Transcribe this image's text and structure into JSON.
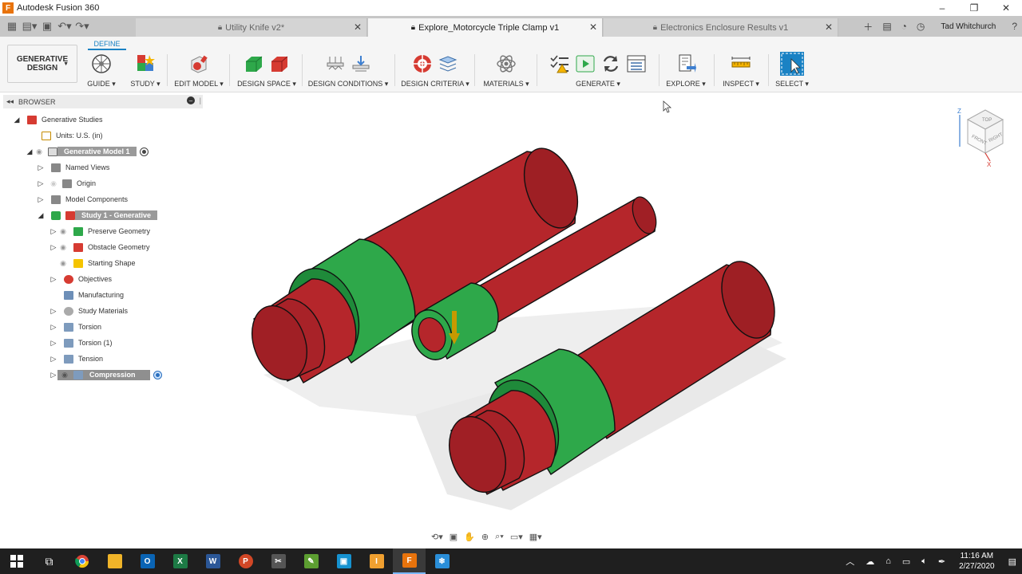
{
  "window": {
    "title": "Autodesk Fusion 360",
    "controls": [
      "–",
      "❐",
      "✕"
    ]
  },
  "tabs": [
    {
      "label": "Utility Knife v2*",
      "active": false
    },
    {
      "label": "Explore_Motorcycle Triple Clamp v1",
      "active": true
    },
    {
      "label": "Electronics Enclosure Results v1",
      "active": false
    }
  ],
  "user": {
    "name": "Tad Whitchurch"
  },
  "toolbar": {
    "define_label": "DEFINE",
    "workspace_label_line1": "GENERATIVE",
    "workspace_label_line2": "DESIGN",
    "groups": [
      {
        "label": "GUIDE ▾"
      },
      {
        "label": "STUDY ▾"
      },
      {
        "label": "EDIT MODEL ▾"
      },
      {
        "label": "DESIGN SPACE ▾"
      },
      {
        "label": "DESIGN CONDITIONS ▾"
      },
      {
        "label": "DESIGN CRITERIA ▾"
      },
      {
        "label": "MATERIALS ▾"
      },
      {
        "label": "GENERATE ▾"
      },
      {
        "label": "EXPLORE ▾"
      },
      {
        "label": "INSPECT ▾"
      },
      {
        "label": "SELECT ▾"
      }
    ]
  },
  "browser": {
    "title": "BROWSER",
    "items": [
      {
        "label": "Generative Studies"
      },
      {
        "label": "Units: U.S. (in)"
      },
      {
        "label": "Generative Model 1"
      },
      {
        "label": "Named Views"
      },
      {
        "label": "Origin"
      },
      {
        "label": "Model Components"
      },
      {
        "label": "Study 1 - Generative"
      },
      {
        "label": "Preserve Geometry"
      },
      {
        "label": "Obstacle Geometry"
      },
      {
        "label": "Starting Shape"
      },
      {
        "label": "Objectives"
      },
      {
        "label": "Manufacturing"
      },
      {
        "label": "Study Materials"
      },
      {
        "label": "Torsion"
      },
      {
        "label": "Torsion (1)"
      },
      {
        "label": "Tension"
      },
      {
        "label": "Compression"
      }
    ]
  },
  "viewcube": {
    "top": "TOP",
    "front": "FRONT",
    "right": "RIGHT",
    "axis_z": "Z",
    "axis_x": "X"
  },
  "colors": {
    "preserve": "#2ea84a",
    "obstacle": "#b5262b",
    "accent": "#1a82c4"
  },
  "taskbar": {
    "time": "11:16 AM",
    "date": "2/27/2020"
  }
}
